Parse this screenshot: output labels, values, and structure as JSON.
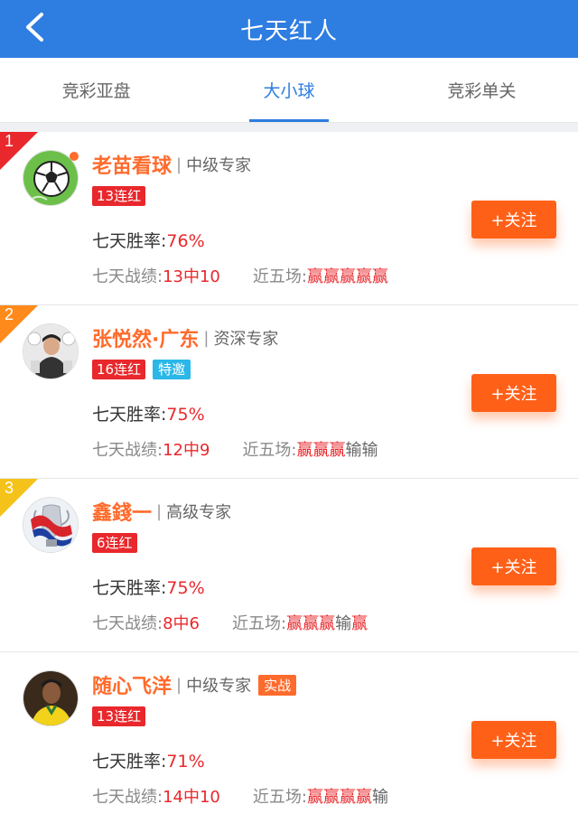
{
  "header": {
    "title": "七天红人"
  },
  "tabs": [
    {
      "label": "竞彩亚盘",
      "active": false
    },
    {
      "label": "大小球",
      "active": true
    },
    {
      "label": "竞彩单关",
      "active": false
    }
  ],
  "labels": {
    "winrate": "七天胜率:",
    "record": "七天战绩:",
    "recent": "近五场:",
    "follow": "+关注"
  },
  "experts": [
    {
      "rank": "1",
      "name": "老苗看球",
      "level": "中级专家",
      "streak": "13连红",
      "winrate": "76%",
      "record": "13中10",
      "recent": [
        "赢",
        "赢",
        "赢",
        "赢",
        "赢"
      ],
      "avatar": "soccer-ball-avatar",
      "extra_tag": "",
      "invite_tag": ""
    },
    {
      "rank": "2",
      "name": "张悦然·广东",
      "level": "资深专家",
      "streak": "16连红",
      "invite_tag": "特邀",
      "winrate": "75%",
      "record": "12中9",
      "recent": [
        "赢",
        "赢",
        "赢",
        "输",
        "输"
      ],
      "avatar": "person-avatar",
      "extra_tag": ""
    },
    {
      "rank": "3",
      "name": "鑫錢一",
      "level": "高级专家",
      "streak": "6连红",
      "winrate": "75%",
      "record": "8中6",
      "recent": [
        "赢",
        "赢",
        "赢",
        "输",
        "赢"
      ],
      "avatar": "trophy-avatar",
      "extra_tag": "",
      "invite_tag": ""
    },
    {
      "rank": "",
      "name": "随心飞洋",
      "level": "中级专家",
      "extra_tag": "实战",
      "streak": "13连红",
      "winrate": "71%",
      "record": "14中10",
      "recent": [
        "赢",
        "赢",
        "赢",
        "赢",
        "输"
      ],
      "avatar": "player-avatar",
      "invite_tag": ""
    }
  ],
  "colors": {
    "brand": "#2e7de1",
    "accent": "#ff6b2c",
    "win": "#e8282c",
    "rank1": "#e8282c",
    "rank2": "#ff8a1c",
    "rank3": "#f5c21a"
  }
}
